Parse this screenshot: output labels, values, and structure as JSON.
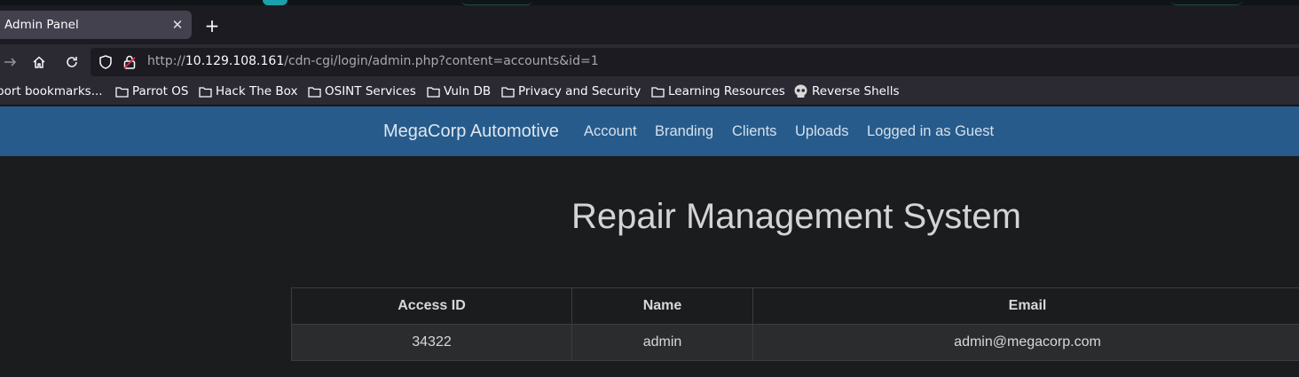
{
  "browser": {
    "tab_title": "Admin Panel",
    "new_tab_icon": "plus-icon",
    "url_scheme": "http://",
    "url_host": "10.129.108.161",
    "url_path": "/cdn-cgi/login/admin.php?content=accounts&id=1",
    "bookmarks": [
      {
        "label": "port bookmarks...",
        "icon": "none"
      },
      {
        "label": "Parrot OS",
        "icon": "folder-icon"
      },
      {
        "label": "Hack The Box",
        "icon": "folder-icon"
      },
      {
        "label": "OSINT Services",
        "icon": "folder-icon"
      },
      {
        "label": "Vuln DB",
        "icon": "folder-icon"
      },
      {
        "label": "Privacy and Security",
        "icon": "folder-icon"
      },
      {
        "label": "Learning Resources",
        "icon": "folder-icon"
      },
      {
        "label": "Reverse Shells",
        "icon": "skull-icon"
      }
    ]
  },
  "site": {
    "brand": "MegaCorp Automotive",
    "nav": [
      "Account",
      "Branding",
      "Clients",
      "Uploads",
      "Logged in as Guest"
    ],
    "accent_color": "#265b8c"
  },
  "main": {
    "title": "Repair Management System",
    "table": {
      "headers": [
        "Access ID",
        "Name",
        "Email"
      ],
      "rows": [
        [
          "34322",
          "admin",
          "admin@megacorp.com"
        ]
      ]
    }
  }
}
